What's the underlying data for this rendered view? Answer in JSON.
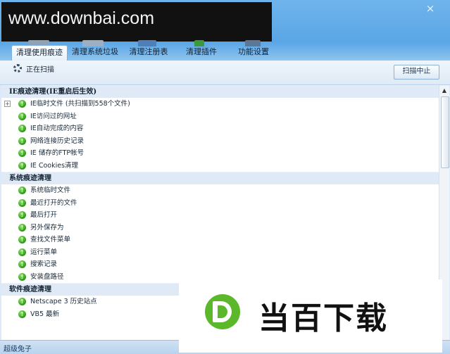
{
  "watermark_top": "www.downbai.com",
  "window": {
    "close_glyph": "×"
  },
  "tabs": [
    {
      "label": "清理使用痕迹",
      "active": true
    },
    {
      "label": "清理系统垃圾",
      "active": false
    },
    {
      "label": "清理注册表",
      "active": false
    },
    {
      "label": "清理插件",
      "active": false
    },
    {
      "label": "功能设置",
      "active": false
    }
  ],
  "scan": {
    "status": "正在扫描",
    "stop_button": "扫描中止"
  },
  "sections": [
    {
      "title": "IE痕迹清理(IE重启后生效)",
      "items": [
        {
          "label": "IE临时文件 (共扫描到558个文件)",
          "expandable": true
        },
        {
          "label": "IE访问过的网址"
        },
        {
          "label": "IE自动完成的内容"
        },
        {
          "label": "网络连接历史记录"
        },
        {
          "label": "IE 储存的FTP帐号"
        },
        {
          "label": "IE Cookies清理"
        }
      ]
    },
    {
      "title": "系统痕迹清理",
      "items": [
        {
          "label": "系统临时文件"
        },
        {
          "label": "最近打开的文件"
        },
        {
          "label": "最后打开"
        },
        {
          "label": "另外保存为"
        },
        {
          "label": "查找文件菜单"
        },
        {
          "label": "运行菜单"
        },
        {
          "label": "搜索记录"
        },
        {
          "label": "安装盘路径"
        }
      ]
    },
    {
      "title": "软件痕迹清理",
      "items": [
        {
          "label": "Netscape 3 历史站点"
        },
        {
          "label": "VB5 最新"
        }
      ]
    }
  ],
  "status_bar": "超级兔子",
  "watermark_bottom": "当百下载",
  "icons": {
    "ok": "check-circle-icon",
    "expander": "plus-box-icon",
    "spinner": "loading-spinner-icon"
  },
  "colors": {
    "title_blue": "#5aa6e6",
    "ok_green": "#2d9a14",
    "section_bg": "#dfeaf6",
    "logo_green": "#5cb82b"
  }
}
